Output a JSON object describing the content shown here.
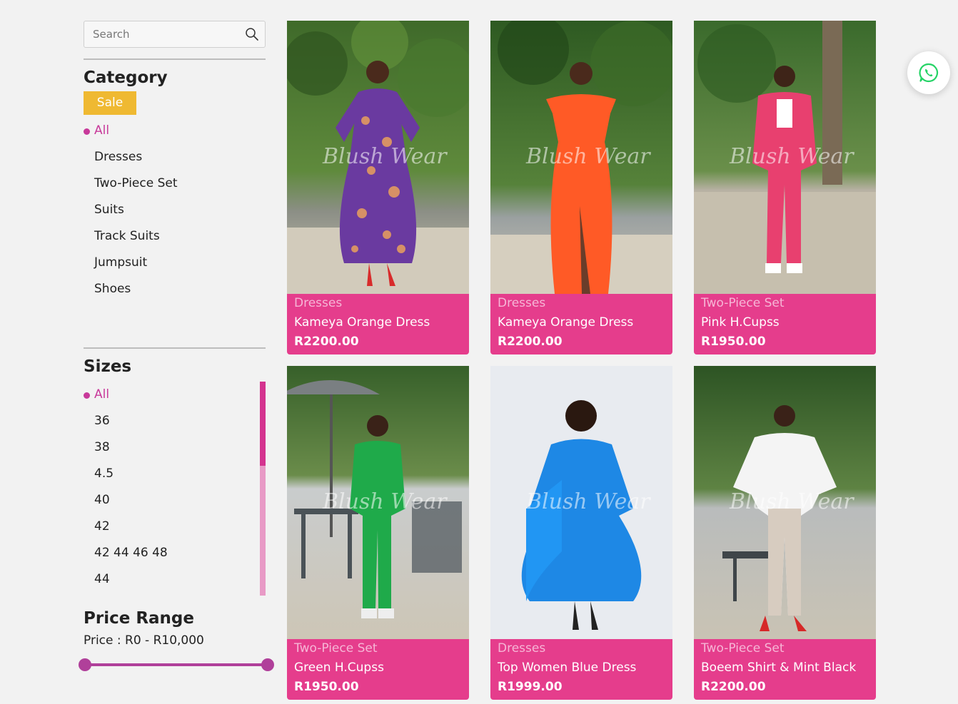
{
  "search": {
    "placeholder": "Search"
  },
  "category": {
    "title": "Category",
    "sale_label": "Sale",
    "items": [
      {
        "label": "All",
        "active": true
      },
      {
        "label": "Dresses",
        "active": false
      },
      {
        "label": "Two-Piece Set",
        "active": false
      },
      {
        "label": "Suits",
        "active": false
      },
      {
        "label": "Track Suits",
        "active": false
      },
      {
        "label": "Jumpsuit",
        "active": false
      },
      {
        "label": "Shoes",
        "active": false
      }
    ]
  },
  "sizes": {
    "title": "Sizes",
    "items": [
      {
        "label": "All",
        "active": true
      },
      {
        "label": "36",
        "active": false
      },
      {
        "label": "38",
        "active": false
      },
      {
        "label": "4.5",
        "active": false
      },
      {
        "label": "40",
        "active": false
      },
      {
        "label": "42",
        "active": false
      },
      {
        "label": "42 44 46 48",
        "active": false
      },
      {
        "label": "44",
        "active": false
      }
    ]
  },
  "price_range": {
    "title": "Price Range",
    "text": "Price : R0 - R10,000",
    "min_fraction": 0,
    "max_fraction": 1
  },
  "watermark_text": "Blush Wear",
  "products": [
    {
      "category": "Dresses",
      "name": "Kameya Orange Dress",
      "price": "R2200.00",
      "garment_color": "#6a3aa0",
      "accent_color": "#e9a05c"
    },
    {
      "category": "Dresses",
      "name": "Kameya Orange Dress",
      "price": "R2200.00",
      "garment_color": "#ff5a26",
      "accent_color": "#ff7a3d"
    },
    {
      "category": "Two-Piece Set",
      "name": "Pink H.Cupss",
      "price": "R1950.00",
      "garment_color": "#e8406f",
      "accent_color": "#ffffff"
    },
    {
      "category": "Two-Piece Set",
      "name": "Green H.Cupss",
      "price": "R1950.00",
      "garment_color": "#1faa4a",
      "accent_color": "#1faa4a"
    },
    {
      "category": "Dresses",
      "name": "Top Women Blue Dress",
      "price": "R1999.00",
      "garment_color": "#1e88e5",
      "accent_color": "#2196f3"
    },
    {
      "category": "Two-Piece Set",
      "name": "Boeem Shirt & Mint Black",
      "price": "R2200.00",
      "garment_color": "#f4f4f4",
      "accent_color": "#d7ccc0"
    }
  ],
  "colors": {
    "accent_pink": "#e53d8c",
    "sale_yellow": "#efb932",
    "active_magenta": "#c8399a",
    "whatsapp_green": "#25d366"
  }
}
